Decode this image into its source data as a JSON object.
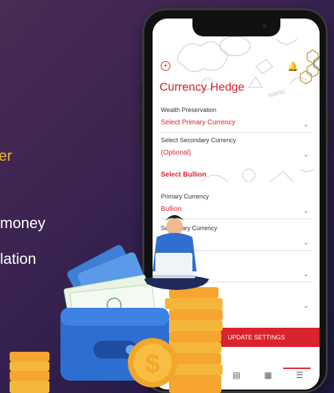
{
  "background_text": {
    "line1": "er",
    "line2": "money",
    "line3": "lation"
  },
  "app": {
    "title": "Currency Hedge",
    "fields": [
      {
        "label": "Wealth Preservation",
        "value": "Select Primary Currency"
      },
      {
        "label": "Select Secondary Currency",
        "value": "(Optional)"
      }
    ],
    "section_bullion": "Select Bullion",
    "bullion_fields": [
      {
        "label": "Primary Currency",
        "value": "Bullion"
      },
      {
        "label": "Secondary Currency",
        "value": "Bullion"
      },
      {
        "label": "",
        "value": "Bullion"
      },
      {
        "label": "",
        "value": ""
      }
    ],
    "update_button": "UPDATE SETTINGS"
  },
  "colors": {
    "accent": "#d9232e",
    "highlight": "#f0b429"
  }
}
